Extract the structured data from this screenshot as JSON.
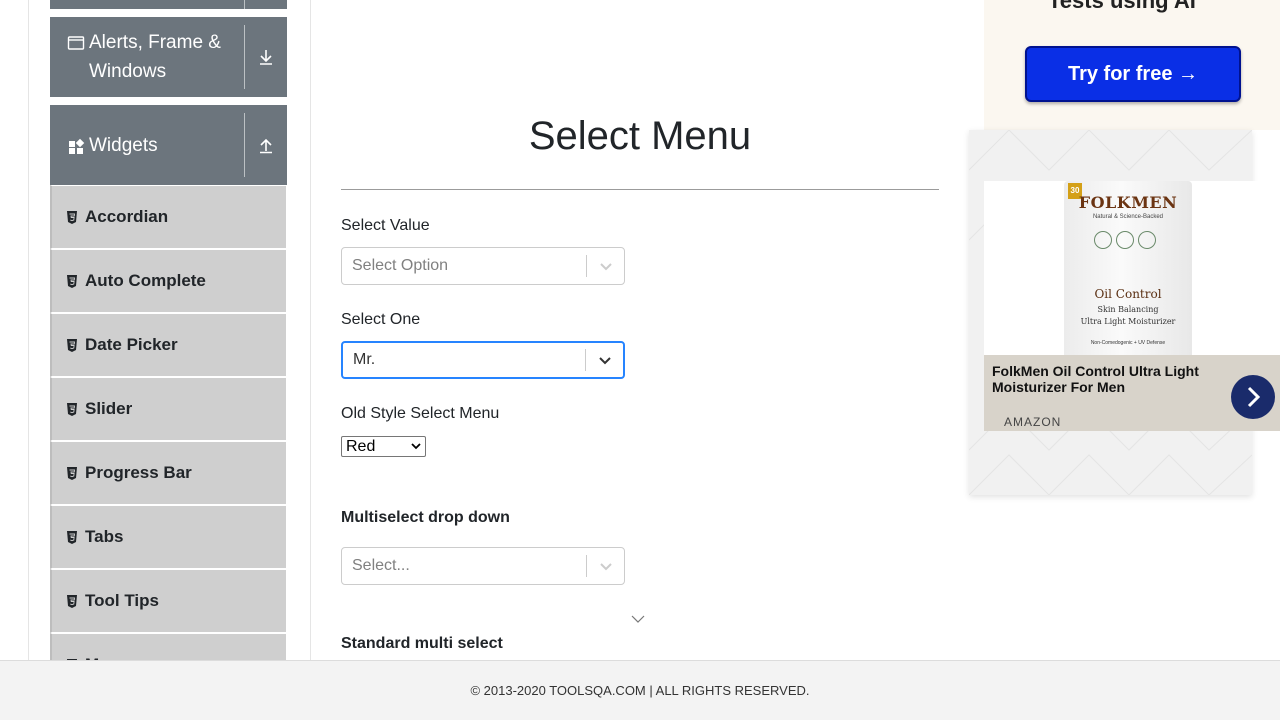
{
  "sidebar": {
    "groups": [
      {
        "label": "Alerts, Frame & Windows",
        "line1": "Alerts, Frame &",
        "line2": "Windows",
        "icon": "window-icon",
        "toggle_icon": "download-arrow-icon"
      },
      {
        "label": "Widgets",
        "icon": "widgets-grid-icon",
        "toggle_icon": "upload-arrow-icon"
      }
    ],
    "items": [
      {
        "label": "Accordian",
        "icon": "html5-icon"
      },
      {
        "label": "Auto Complete",
        "icon": "html5-icon"
      },
      {
        "label": "Date Picker",
        "icon": "html5-icon"
      },
      {
        "label": "Slider",
        "icon": "html5-icon"
      },
      {
        "label": "Progress Bar",
        "icon": "html5-icon"
      },
      {
        "label": "Tabs",
        "icon": "html5-icon"
      },
      {
        "label": "Tool Tips",
        "icon": "html5-icon"
      },
      {
        "label": "Menu",
        "icon": "html5-icon"
      }
    ]
  },
  "main": {
    "title": "Select Menu",
    "select_value": {
      "label": "Select Value",
      "placeholder": "Select Option"
    },
    "select_one": {
      "label": "Select One",
      "value": "Mr."
    },
    "old_style": {
      "label": "Old Style Select Menu",
      "value": "Red"
    },
    "multiselect": {
      "label": "Multiselect drop down",
      "placeholder": "Select..."
    },
    "standard_multi": {
      "label": "Standard multi select"
    }
  },
  "ads": {
    "top": {
      "tagline": "Tests using AI",
      "cta": "Try for free →"
    },
    "card": {
      "badge": "30",
      "brand": "FOLKMEN",
      "brand_sub": "Natural & Science-Backed",
      "product_name": "Oil Control",
      "product_desc_1": "Skin Balancing",
      "product_desc_2": "Ultra Light Moisturizer",
      "product_tiny": "Non-Comedogenic + UV Defense",
      "caption": "FolkMen Oil Control Ultra Light Moisturizer For Men",
      "source": "AMAZON"
    }
  },
  "footer": {
    "text": "© 2013-2020 TOOLSQA.COM | ALL RIGHTS RESERVED."
  },
  "colors": {
    "sidebar_header": "#6c757d",
    "menu_item": "#cfcfcf",
    "focus_border": "#2684ff",
    "cta_blue": "#0a2fe6"
  }
}
